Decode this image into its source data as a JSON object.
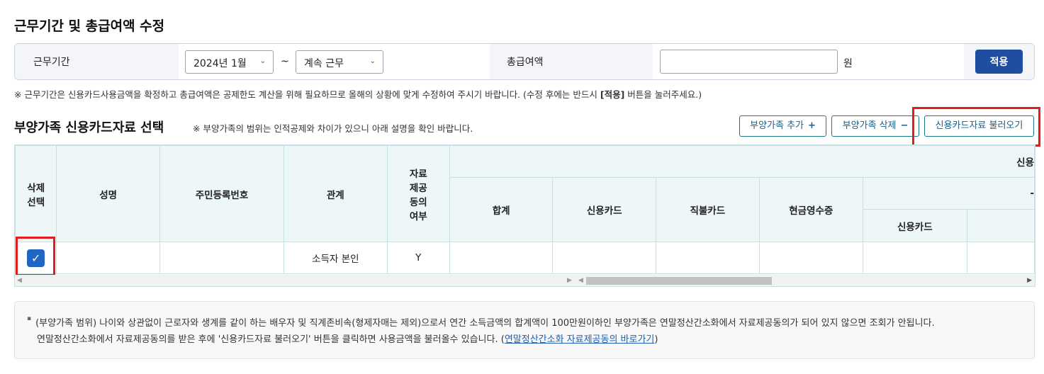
{
  "section_title": "근무기간 및 총급여액 수정",
  "period": {
    "label": "근무기간",
    "start_value": "2024년 1월",
    "separator": "~",
    "end_value": "계속 근무",
    "salary_label": "총급여액",
    "salary_value": "",
    "unit": "원",
    "apply_label": "적용"
  },
  "note_parts": {
    "pre": "※ 근무기간은 신용카드사용금액을 확정하고 총급여액은 공제한도 계산을 위해 필요하므로 올해의 상황에 맞게 수정하여 주시기 바랍니다. (수정 후에는 반드시 ",
    "bold": "[적용]",
    "post": " 버튼을 눌러주세요.)"
  },
  "dependents": {
    "title": "부양가족 신용카드자료 선택",
    "note": "※ 부양가족의 범위는 인적공제와 차이가 있으니 아래 설명을 확인 바랍니다.",
    "add_label": "부양가족 추가",
    "add_icon": "+",
    "delete_label": "부양가족 삭제",
    "delete_icon": "−",
    "load_label": "신용카드자료 불러오기"
  },
  "table": {
    "headers": {
      "delete_select": "삭제\n선택",
      "name": "성명",
      "rrn": "주민등록번호",
      "relation": "관계",
      "consent": "자료\n제공\n동의\n여부",
      "group_credit": "신용",
      "total": "합계",
      "credit_card": "신용카드",
      "debit_card": "직불카드",
      "cash_receipt": "현금영수증",
      "group_sub": "-",
      "sub_credit_card": "신용카드"
    },
    "rows": [
      {
        "checked": true,
        "name": "",
        "rrn": "",
        "relation": "소득자 본인",
        "consent": "Y"
      }
    ]
  },
  "info": {
    "line1": "(부양가족 범위) 나이와 상관없이 근로자와 생계를 같이 하는 배우자 및 직계존비속(형제자매는 제외)으로서 연간 소득금액의 합계액이 100만원이하인 부양가족은 연말정산간소화에서 자료제공동의가 되어 있지 않으면 조회가 안됩니다.",
    "line2_pre": "연말정산간소화에서 자료제공동의를 받은 후에 '신용카드자료 불러오기' 버튼을 클릭하면 사용금액을 불러올수 있습니다. (",
    "link": "연말정산간소화 자료제공동의 바로가기",
    "line2_post": ")"
  },
  "colors": {
    "primary": "#1f4ea1",
    "table_header_bg": "#eef7f8",
    "highlight": "#e41c1c",
    "checkbox": "#2266c4"
  }
}
